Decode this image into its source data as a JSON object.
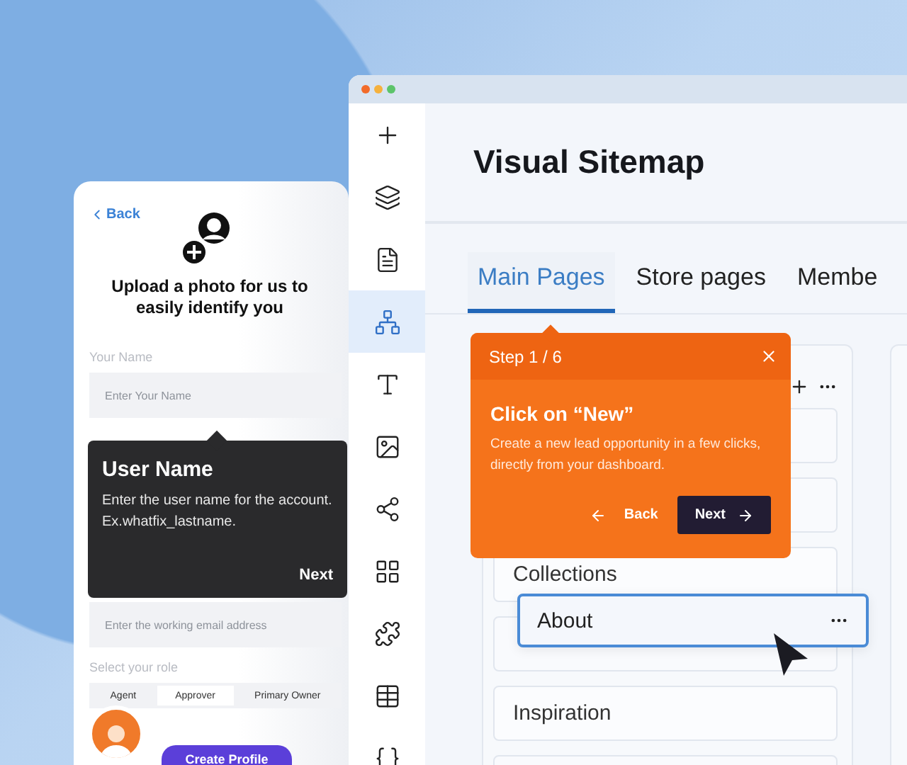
{
  "profile_form": {
    "back_link": "Back",
    "heading": "Upload a photo for us to easily identify you",
    "name_field": {
      "label": "Your Name",
      "placeholder": "Enter Your Name"
    },
    "email_field": {
      "placeholder": "Enter the working email address"
    },
    "role": {
      "label": "Select your role",
      "options": [
        {
          "label": "Agent",
          "selected": false
        },
        {
          "label": "Approver",
          "selected": true
        },
        {
          "label": "Primary Owner",
          "selected": false
        }
      ]
    },
    "submit": "Create Profile"
  },
  "name_tip": {
    "title": "User Name",
    "text": "Enter the user name for the account. Ex.whatfix_lastname.",
    "next": "Next"
  },
  "sitemap_window": {
    "title": "Visual Sitemap",
    "sidebar": [
      {
        "kind": "plus",
        "selected": false
      },
      {
        "kind": "layers",
        "selected": false
      },
      {
        "kind": "page",
        "selected": false
      },
      {
        "kind": "sitemap",
        "selected": true
      },
      {
        "kind": "fonts",
        "selected": false
      },
      {
        "kind": "image",
        "selected": false
      },
      {
        "kind": "nodes",
        "selected": false
      },
      {
        "kind": "grid",
        "selected": false
      },
      {
        "kind": "apps",
        "selected": false
      },
      {
        "kind": "table",
        "selected": false
      },
      {
        "kind": "code",
        "selected": false
      }
    ],
    "tabs": [
      {
        "label": "Main Pages",
        "selected": true
      },
      {
        "label": "Store pages",
        "selected": false
      },
      {
        "label": "Membe",
        "selected": false
      }
    ],
    "pages": [
      {
        "kind": "blank"
      },
      {
        "kind": "blank"
      },
      {
        "kind": "named",
        "label": "Collections"
      },
      {
        "kind": "blank"
      },
      {
        "kind": "named",
        "label": "Inspiration"
      },
      {
        "kind": "blank"
      }
    ],
    "dragged_page": {
      "label": "About"
    }
  },
  "step_tip": {
    "step": "Step 1 / 6",
    "title": "Click on “New”",
    "text": "Create a new lead opportunity in a few clicks, directly from your dashboard.",
    "back": "Back",
    "next": "Next"
  }
}
